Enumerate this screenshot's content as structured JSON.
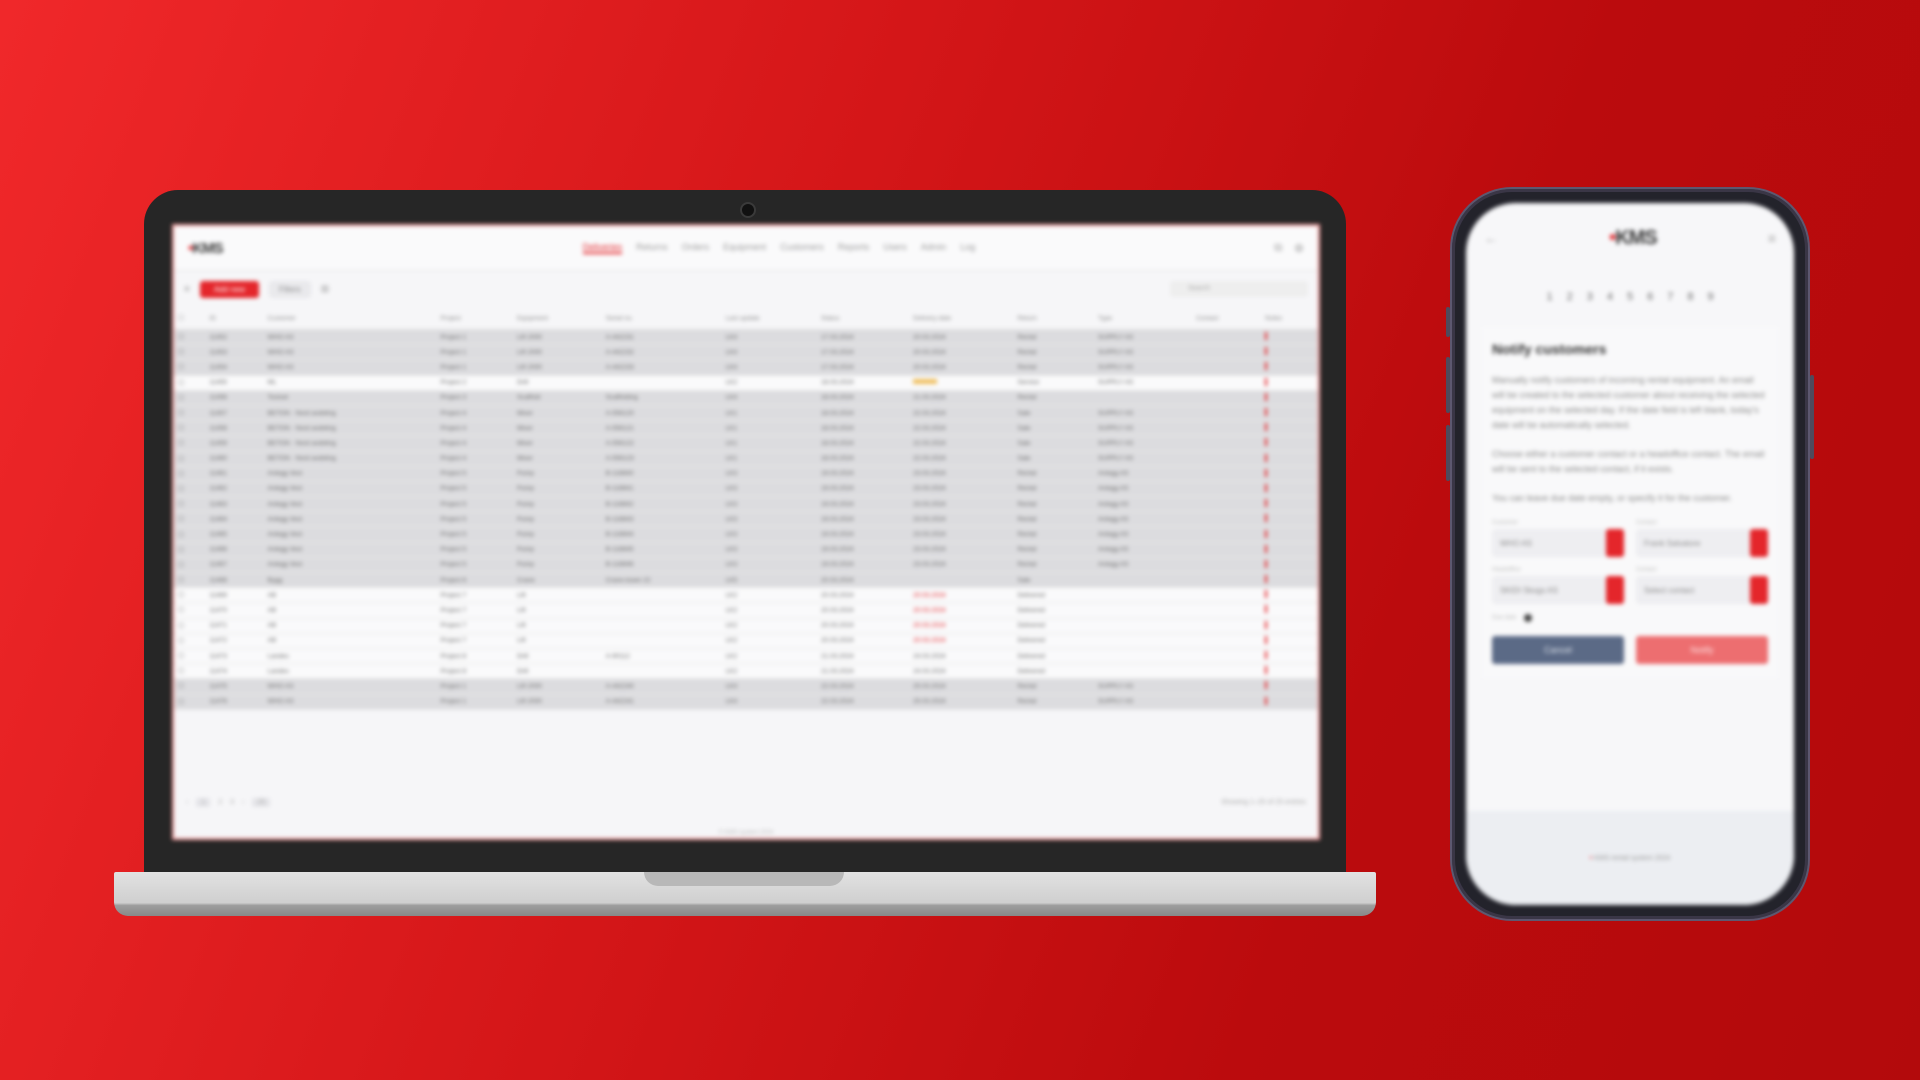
{
  "desktop": {
    "logo_accent": "•",
    "logo": "KMS",
    "nav": [
      "Deliveries",
      "Returns",
      "Orders",
      "Equipment",
      "Customers",
      "Reports",
      "Users",
      "Admin",
      "Log"
    ],
    "toolbar": {
      "primary": "Add new",
      "secondary": "Filters",
      "search_placeholder": "Search"
    },
    "columns": [
      "ID",
      "Customer",
      "Project",
      "Equipment",
      "Serial no.",
      "Last update",
      "Status",
      "Delivery date",
      "Return",
      "Type",
      "Contact",
      "Notes"
    ],
    "rows": [
      {
        "style": "shaded",
        "cells": [
          "11452",
          "WHO AS",
          "Project 1",
          "Lift 2000",
          "A-442231",
          "LK4",
          "17.03.2024",
          "20.03.2024",
          "Rental",
          "SUPPLY AS",
          ""
        ]
      },
      {
        "style": "shaded",
        "cells": [
          "11453",
          "WHO AS",
          "Project 1",
          "Lift 2000",
          "A-442232",
          "LK4",
          "17.03.2024",
          "20.03.2024",
          "Rental",
          "SUPPLY AS",
          ""
        ]
      },
      {
        "style": "shaded",
        "cells": [
          "11454",
          "WHO AS",
          "Project 1",
          "Lift 2000",
          "A-442233",
          "LK4",
          "17.03.2024",
          "20.03.2024",
          "Rental",
          "SUPPLY AS",
          ""
        ]
      },
      {
        "style": "plain",
        "cells": [
          "11455",
          "ML",
          "Project 2",
          "Drill",
          "",
          "LK2",
          "18.03.2024",
          "hl",
          "Service",
          "SUPPLY AS",
          ""
        ]
      },
      {
        "style": "shaded",
        "cells": [
          "11456",
          "Toolset",
          "Project 3",
          "Scaffold",
          "Scaffolding",
          "LK4",
          "18.03.2024",
          "21.03.2024",
          "Rental",
          "",
          ""
        ]
      },
      {
        "style": "shaded",
        "cells": [
          "11457",
          "BETON · Nord avdeling",
          "Project 4",
          "Mixer",
          "A-556120",
          "LK1",
          "18.03.2024",
          "22.03.2024",
          "Sale",
          "SUPPLY AS",
          ""
        ]
      },
      {
        "style": "shaded",
        "cells": [
          "11458",
          "BETON · Nord avdeling",
          "Project 4",
          "Mixer",
          "A-556121",
          "LK1",
          "18.03.2024",
          "22.03.2024",
          "Sale",
          "SUPPLY AS",
          ""
        ]
      },
      {
        "style": "shaded",
        "cells": [
          "11459",
          "BETON · Nord avdeling",
          "Project 4",
          "Mixer",
          "A-556122",
          "LK1",
          "18.03.2024",
          "22.03.2024",
          "Sale",
          "SUPPLY AS",
          ""
        ]
      },
      {
        "style": "shaded",
        "cells": [
          "11460",
          "BETON · Nord avdeling",
          "Project 4",
          "Mixer",
          "A-556123",
          "LK1",
          "18.03.2024",
          "22.03.2024",
          "Sale",
          "SUPPLY AS",
          ""
        ]
      },
      {
        "style": "shaded",
        "cells": [
          "11461",
          "Anlegg Vest",
          "Project 5",
          "Pump",
          "B-118840",
          "LK3",
          "19.03.2024",
          "23.03.2024",
          "Rental",
          "Anlegg AS",
          ""
        ]
      },
      {
        "style": "shaded",
        "cells": [
          "11462",
          "Anlegg Vest",
          "Project 5",
          "Pump",
          "B-118841",
          "LK3",
          "19.03.2024",
          "23.03.2024",
          "Rental",
          "Anlegg AS",
          ""
        ]
      },
      {
        "style": "shaded",
        "cells": [
          "11463",
          "Anlegg Vest",
          "Project 5",
          "Pump",
          "B-118842",
          "LK3",
          "19.03.2024",
          "23.03.2024",
          "Rental",
          "Anlegg AS",
          ""
        ]
      },
      {
        "style": "shaded",
        "cells": [
          "11464",
          "Anlegg Vest",
          "Project 5",
          "Pump",
          "B-118843",
          "LK3",
          "19.03.2024",
          "23.03.2024",
          "Rental",
          "Anlegg AS",
          ""
        ]
      },
      {
        "style": "shaded",
        "cells": [
          "11465",
          "Anlegg Vest",
          "Project 5",
          "Pump",
          "B-118844",
          "LK3",
          "19.03.2024",
          "23.03.2024",
          "Rental",
          "Anlegg AS",
          ""
        ]
      },
      {
        "style": "shaded",
        "cells": [
          "11466",
          "Anlegg Vest",
          "Project 5",
          "Pump",
          "B-118845",
          "LK3",
          "19.03.2024",
          "23.03.2024",
          "Rental",
          "Anlegg AS",
          ""
        ]
      },
      {
        "style": "shaded",
        "cells": [
          "11467",
          "Anlegg Vest",
          "Project 5",
          "Pump",
          "B-118846",
          "LK3",
          "19.03.2024",
          "23.03.2024",
          "Rental",
          "Anlegg AS",
          ""
        ]
      },
      {
        "style": "shaded",
        "cells": [
          "11468",
          "Bygg",
          "Project 6",
          "Crane",
          "Crane-tower 22",
          "LK5",
          "20.03.2024",
          "",
          "Sale",
          "",
          ""
        ]
      },
      {
        "style": "plain",
        "cells": [
          "11469",
          "AB",
          "Project 7",
          "Lift",
          "",
          "LK2",
          "20.03.2024",
          "rd",
          "Delivered",
          "",
          ""
        ]
      },
      {
        "style": "plain",
        "cells": [
          "11470",
          "AB",
          "Project 7",
          "Lift",
          "",
          "LK2",
          "20.03.2024",
          "rd",
          "Delivered",
          "",
          ""
        ]
      },
      {
        "style": "plain",
        "cells": [
          "11471",
          "AB",
          "Project 7",
          "Lift",
          "",
          "LK2",
          "20.03.2024",
          "rd",
          "Delivered",
          "",
          ""
        ]
      },
      {
        "style": "plain",
        "cells": [
          "11472",
          "AB",
          "Project 7",
          "Lift",
          "",
          "LK2",
          "20.03.2024",
          "rd",
          "Delivered",
          "",
          ""
        ]
      },
      {
        "style": "plain",
        "cells": [
          "11473",
          "Landes",
          "Project 8",
          "Drill",
          "A-90112",
          "LK2",
          "21.03.2024",
          "24.03.2024",
          "Delivered",
          "",
          ""
        ]
      },
      {
        "style": "plain",
        "cells": [
          "11474",
          "Landes",
          "Project 8",
          "Drill",
          "",
          "LK2",
          "21.03.2024",
          "24.03.2024",
          "Delivered",
          "",
          ""
        ]
      },
      {
        "style": "shaded",
        "cells": [
          "11475",
          "WHO AS",
          "Project 1",
          "Lift 2000",
          "A-442240",
          "LK4",
          "22.03.2024",
          "25.03.2024",
          "Rental",
          "SUPPLY AS",
          ""
        ]
      },
      {
        "style": "shaded",
        "cells": [
          "11476",
          "WHO AS",
          "Project 1",
          "Lift 2000",
          "A-442241",
          "LK4",
          "22.03.2024",
          "25.03.2024",
          "Rental",
          "SUPPLY AS",
          ""
        ]
      }
    ],
    "pager": {
      "prev": "‹",
      "current": "1",
      "p2": "2",
      "p3": "3",
      "next": "›",
      "size": "25"
    },
    "status": "Showing 1–25 of 25 entries",
    "copyright": "© KMS system 2024"
  },
  "mobile": {
    "logo_accent": "•",
    "logo": "KMS",
    "steps": [
      "1",
      "2",
      "3",
      "4",
      "5",
      "6",
      "7",
      "8",
      "9"
    ],
    "title": "Notify customers",
    "paragraphs": [
      "Manually notify customers of incoming rental equipment. An email will be created to the selected customer about receiving the selected equipment on the selected day. If the date field is left blank, today's date will be automatically selected.",
      "Choose either a customer contact or a headoffice contact. The email will be sent to the selected contact, if it exists.",
      "You can leave due date empty, or specify it for the customer."
    ],
    "fields": [
      {
        "label": "Customer",
        "value": "WHO AS"
      },
      {
        "label": "Contact",
        "value": "Frank Salvatore"
      },
      {
        "label": "Headoffice",
        "value": "SKIDI Skogs AS"
      },
      {
        "label": "Contact",
        "value": "Select contact"
      }
    ],
    "toggle_label": "Due date",
    "cancel": "Cancel",
    "notify": "Notify",
    "footer_accent": "•",
    "footer": "KMS rental system 2024"
  },
  "colors": {
    "accent": "#e4262b",
    "cancel": "#5b6a86",
    "notify": "#ed6e70"
  }
}
